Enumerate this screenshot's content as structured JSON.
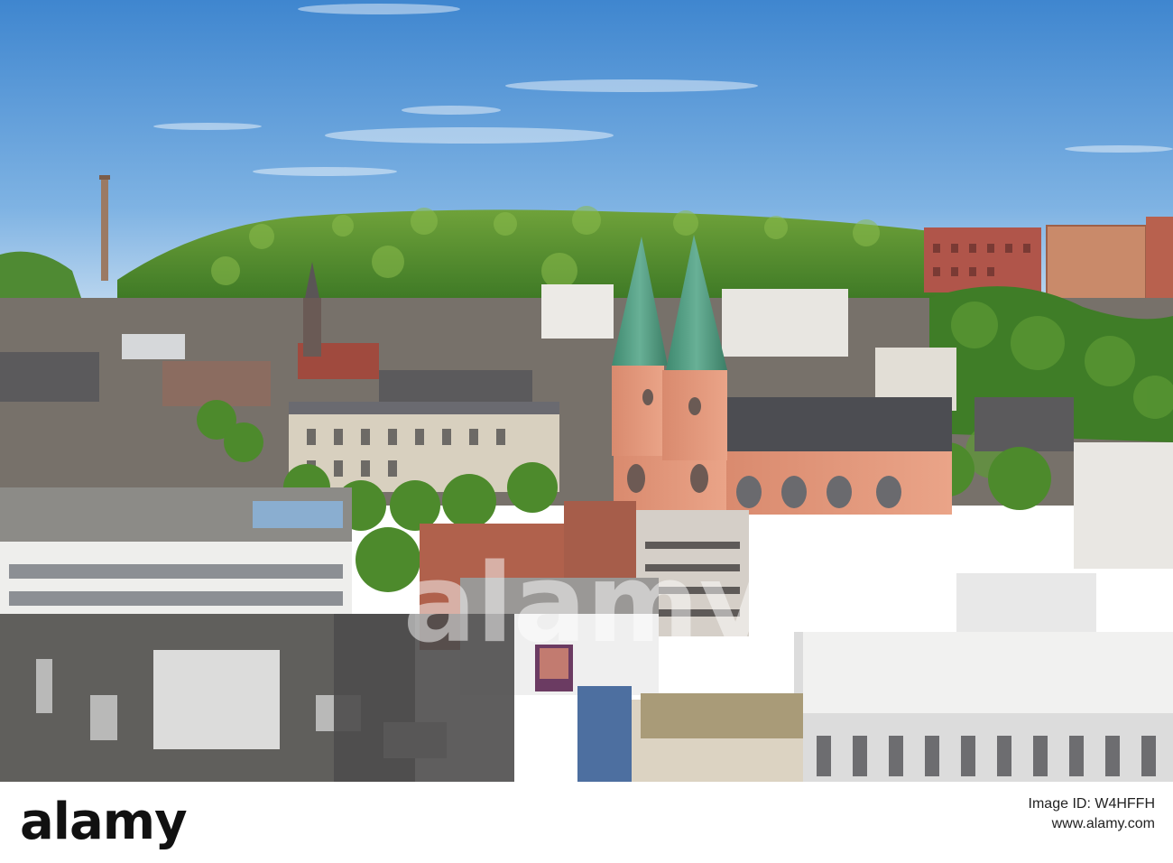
{
  "photo": {
    "subject": "city-aerial-view",
    "colors": {
      "sky_top": "#3f86cf",
      "sky_bottom": "#a9cdec",
      "forest": "#4c8a2c",
      "forest_light": "#86b544",
      "roof_grey": "#5b5d62",
      "church_wall": "#e2967a",
      "spire_copper": "#4e9a80",
      "building_white": "#e8e8e6"
    }
  },
  "watermark": {
    "text": "alamy"
  },
  "footer": {
    "logo": "alamy",
    "image_id_label": "Image ID: W4HFFH",
    "url": "www.alamy.com"
  }
}
